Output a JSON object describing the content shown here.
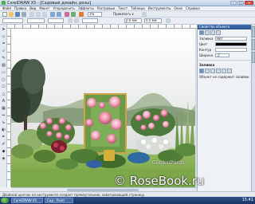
{
  "window": {
    "title": "CorelDRAW X5 - [Садовый дизайн, розы]"
  },
  "menu": [
    "Файл",
    "Правка",
    "Вид",
    "Макет",
    "Упорядочить",
    "Эффекты",
    "Растровые",
    "Текст",
    "Таблица",
    "Инструменты",
    "Окно",
    "Справка"
  ],
  "toolbar": {
    "zoom_value": "3%",
    "snap_label": "Привязать к",
    "width_value": "0.0 мм",
    "height_value": "0.0 мм"
  },
  "docker": {
    "title": "Свойства объекта",
    "fill_label": "Заливка",
    "fill_value": "Нет",
    "color_label": "Цвет",
    "outline_label": "Контур",
    "width_label": "Ширина",
    "width_value": ".2",
    "section_label": "Заливка",
    "note": "Объект не содержит заливки"
  },
  "canvas": {
    "watermark": "GardenPuzzle"
  },
  "status": {
    "text": "Двойной щелчок на инструменте создает прямоугольник, охватывающий страницу"
  },
  "taskbar": {
    "tasks": [
      "CorelDRAW X5",
      "Сад - Paint"
    ],
    "clock": "15:41"
  },
  "watermark": {
    "text": "© RoseBook.ru"
  }
}
